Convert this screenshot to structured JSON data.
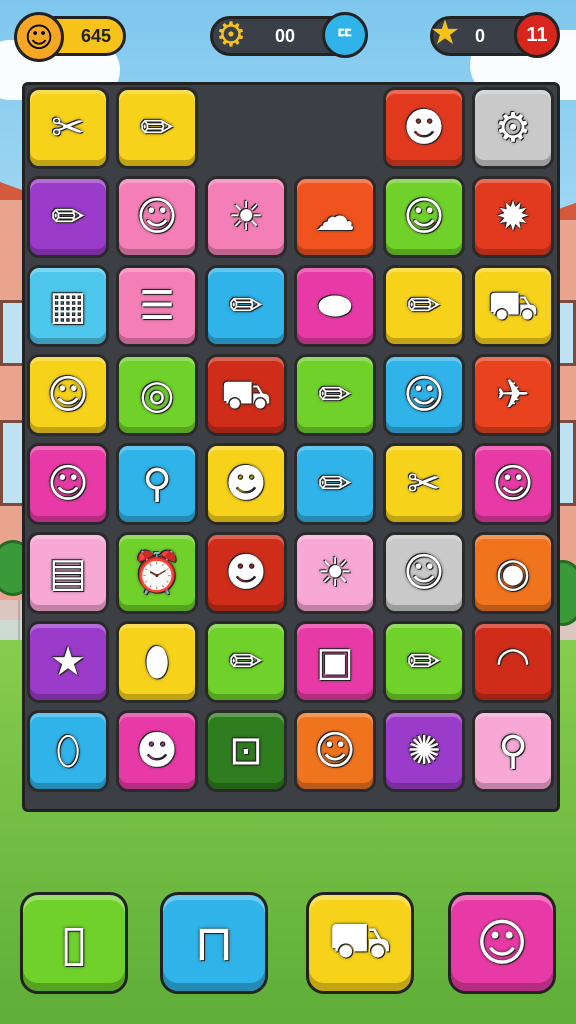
{
  "hud": {
    "player_avatar_icon": "girl-face-icon",
    "coins_value": "645",
    "gear_count": "00",
    "gear_button_label": "ᄄ",
    "stars_count": "0",
    "level_label": "11"
  },
  "board": {
    "rows": [
      [
        {
          "icon": "scissors-icon",
          "color": "#f7d21a"
        },
        {
          "icon": "pencil-icon",
          "color": "#f7d21a"
        },
        null,
        null,
        {
          "icon": "robot-face-icon",
          "color": "#e23a1f"
        },
        {
          "icon": "hairdryer-icon",
          "color": "#c9c9c9"
        }
      ],
      [
        {
          "icon": "pencil-icon",
          "color": "#9b3bc9"
        },
        {
          "icon": "boy-hat-icon",
          "color": "#f47fb6"
        },
        {
          "icon": "sun-icon",
          "color": "#f47fb6"
        },
        {
          "icon": "slime-icon",
          "color": "#f0531e"
        },
        {
          "icon": "girl-face-icon",
          "color": "#6fd12a"
        },
        {
          "icon": "germ-icon",
          "color": "#e23a1f"
        }
      ],
      [
        {
          "icon": "palette-icon",
          "color": "#4ec7ec"
        },
        {
          "icon": "notepad-icon",
          "color": "#f47fb6"
        },
        {
          "icon": "pencil-icon",
          "color": "#2fb3e8"
        },
        {
          "icon": "lemon-icon",
          "color": "#e83aa6"
        },
        {
          "icon": "pencil-icon",
          "color": "#f7d21a"
        },
        {
          "icon": "toy-car-icon",
          "color": "#f7d21a"
        }
      ],
      [
        {
          "icon": "girl-face-icon",
          "color": "#f7d21a"
        },
        {
          "icon": "target-icon",
          "color": "#6fd12a"
        },
        {
          "icon": "toy-car-icon",
          "color": "#cf2d1a"
        },
        {
          "icon": "pencil-icon",
          "color": "#6fd12a"
        },
        {
          "icon": "boy-face-icon",
          "color": "#2fb3e8"
        },
        {
          "icon": "paper-plane-icon",
          "color": "#e8421e"
        }
      ],
      [
        {
          "icon": "girl-face-icon",
          "color": "#e83aa6"
        },
        {
          "icon": "spinning-top-icon",
          "color": "#2fb3e8"
        },
        {
          "icon": "monster-icon",
          "color": "#f7d21a"
        },
        {
          "icon": "pencil-icon",
          "color": "#2fb3e8"
        },
        {
          "icon": "scissors-icon",
          "color": "#f7d21a"
        },
        {
          "icon": "girl-face-icon",
          "color": "#e83aa6"
        }
      ],
      [
        {
          "icon": "calculator-icon",
          "color": "#f7a8d4"
        },
        {
          "icon": "alarm-clock-icon",
          "color": "#6fd12a"
        },
        {
          "icon": "clown-face-icon",
          "color": "#cf2d1a"
        },
        {
          "icon": "sun-icon",
          "color": "#f7a8d4"
        },
        {
          "icon": "boy-hat-icon",
          "color": "#c9c9c9"
        },
        {
          "icon": "lollipop-icon",
          "color": "#f0731e"
        }
      ],
      [
        {
          "icon": "star-icon",
          "color": "#9b3bc9"
        },
        {
          "icon": "punching-bag-icon",
          "color": "#f7d21a"
        },
        {
          "icon": "pencil-icon",
          "color": "#6fd12a"
        },
        {
          "icon": "box-icon",
          "color": "#e83aa6"
        },
        {
          "icon": "pencil-icon",
          "color": "#6fd12a"
        },
        {
          "icon": "rainbow-icon",
          "color": "#cf2d1a"
        }
      ],
      [
        {
          "icon": "water-drop-icon",
          "color": "#2fb3e8"
        },
        {
          "icon": "teddy-bear-icon",
          "color": "#e83aa6"
        },
        {
          "icon": "robot-icon",
          "color": "#2e7d1e"
        },
        {
          "icon": "mouse-face-icon",
          "color": "#f0731e"
        },
        {
          "icon": "flower-icon",
          "color": "#9b3bc9"
        },
        {
          "icon": "magnifier-icon",
          "color": "#f7a8d4"
        }
      ]
    ]
  },
  "powerups": [
    {
      "icon": "phone-card-icon",
      "color": "#6fd12a"
    },
    {
      "icon": "lock-bag-icon",
      "color": "#2fb3e8"
    },
    {
      "icon": "toy-car-icon",
      "color": "#f7d21a"
    },
    {
      "icon": "smiley-ball-icon",
      "color": "#e83aa6"
    }
  ],
  "icon_glyphs": {
    "girl-face-icon": "☺",
    "boy-face-icon": "☺",
    "boy-hat-icon": "☺",
    "scissors-icon": "✂",
    "pencil-icon": "✏",
    "robot-face-icon": "☻",
    "hairdryer-icon": "⚙",
    "sun-icon": "☀",
    "slime-icon": "☁",
    "germ-icon": "✹",
    "palette-icon": "▦",
    "notepad-icon": "☰",
    "lemon-icon": "⬬",
    "toy-car-icon": "⛟",
    "target-icon": "◎",
    "paper-plane-icon": "✈",
    "spinning-top-icon": "⚲",
    "monster-icon": "☻",
    "calculator-icon": "▤",
    "alarm-clock-icon": "⏰",
    "clown-face-icon": "☻",
    "lollipop-icon": "◉",
    "star-icon": "★",
    "punching-bag-icon": "⬮",
    "box-icon": "▣",
    "rainbow-icon": "◠",
    "water-drop-icon": "⬯",
    "teddy-bear-icon": "☻",
    "robot-icon": "⊡",
    "mouse-face-icon": "☺",
    "flower-icon": "✺",
    "magnifier-icon": "⚲",
    "phone-card-icon": "▯",
    "lock-bag-icon": "⊓",
    "smiley-ball-icon": "☺",
    "gear-icon": "⚙"
  }
}
